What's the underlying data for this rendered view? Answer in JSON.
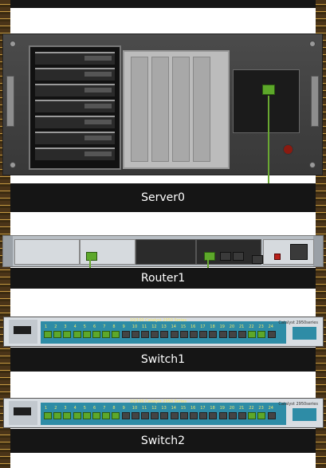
{
  "devices": {
    "server": {
      "name": "Server0"
    },
    "router": {
      "name": "Router1"
    },
    "switch1": {
      "name": "Switch1",
      "model": "10/100 Catalyst 2950 Series",
      "brand": "Catalyst 2950series"
    },
    "switch2": {
      "name": "Switch2",
      "model": "10/100 Catalyst 2950 Series",
      "brand": "Catalyst 2950series"
    }
  },
  "switch_port_numbers": [
    "1",
    "2",
    "3",
    "4",
    "5",
    "6",
    "7",
    "8",
    "9",
    "10",
    "11",
    "12",
    "13",
    "14",
    "15",
    "16",
    "17",
    "18",
    "19",
    "20",
    "21",
    "22",
    "23",
    "24"
  ],
  "colors": {
    "rack_bg": "#151515",
    "rail": "#c59a43",
    "cable": "#6aa832",
    "port_active": "#5da82a",
    "switch_face": "#2e8ca6"
  }
}
